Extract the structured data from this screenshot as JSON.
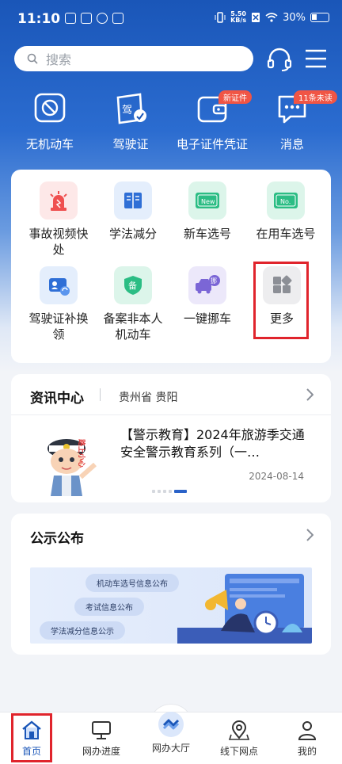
{
  "status_bar": {
    "time": "11:10",
    "speed": "5.50\nKB/s",
    "battery": "30%"
  },
  "search": {
    "placeholder": "搜索"
  },
  "top_features": [
    {
      "label": "无机动车",
      "icon": "no-vehicle-icon",
      "badge": ""
    },
    {
      "label": "驾驶证",
      "icon": "driver-license-icon",
      "badge": ""
    },
    {
      "label": "电子证件凭证",
      "icon": "wallet-icon",
      "badge": "新证件"
    },
    {
      "label": "消息",
      "icon": "message-icon",
      "badge": "11条未读"
    }
  ],
  "services": [
    {
      "label": "事故视频快处",
      "icon": "alarm-light-icon"
    },
    {
      "label": "学法减分",
      "icon": "book-icon"
    },
    {
      "label": "新车选号",
      "icon": "new-plate-icon"
    },
    {
      "label": "在用车选号",
      "icon": "no-plate-icon"
    },
    {
      "label": "驾驶证补换领",
      "icon": "license-replace-icon"
    },
    {
      "label": "备案非本人机动车",
      "icon": "record-icon"
    },
    {
      "label": "一键挪车",
      "icon": "move-car-icon"
    },
    {
      "label": "更多",
      "icon": "more-grid-icon"
    }
  ],
  "news": {
    "title": "资讯中心",
    "region": "贵州省 贵阳",
    "headline": "【警示教育】2024年旅游季交通安全警示教育系列（一…",
    "thumb_text": "路上小心",
    "date": "2024-08-14"
  },
  "notice": {
    "title": "公示公布",
    "pills": [
      "机动车选号信息公布",
      "考试信息公布",
      "学法减分信息公示"
    ]
  },
  "tabs": [
    {
      "label": "首页",
      "icon": "home-icon"
    },
    {
      "label": "网办进度",
      "icon": "monitor-icon"
    },
    {
      "label": "网办大厅",
      "icon": "hall-icon"
    },
    {
      "label": "线下网点",
      "icon": "map-pin-icon"
    },
    {
      "label": "我的",
      "icon": "user-icon"
    }
  ],
  "colors": {
    "brand_blue": "#1a56b8",
    "badge_red": "#f05545",
    "highlight_red": "#e0242c"
  }
}
